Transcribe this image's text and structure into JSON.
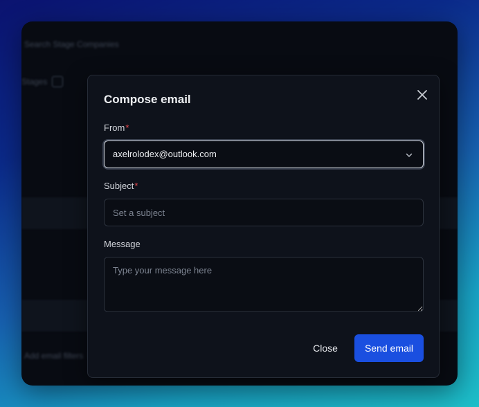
{
  "background": {
    "header_text": "Search Stage Companies",
    "toolbar_text": "Stages",
    "footer_text": "Add email filters"
  },
  "modal": {
    "title": "Compose email",
    "from": {
      "label": "From",
      "required_mark": "*",
      "value": "axelrolodex@outlook.com"
    },
    "subject": {
      "label": "Subject",
      "required_mark": "*",
      "value": "",
      "placeholder": "Set a subject"
    },
    "message": {
      "label": "Message",
      "value": "",
      "placeholder": "Type your message here"
    },
    "buttons": {
      "close_label": "Close",
      "send_label": "Send email"
    },
    "icons": {
      "close": "close-icon",
      "dropdown": "chevron-down-icon"
    }
  },
  "colors": {
    "accent": "#1a4fe0",
    "required": "#e5484d",
    "modal_bg": "#0e121b"
  }
}
